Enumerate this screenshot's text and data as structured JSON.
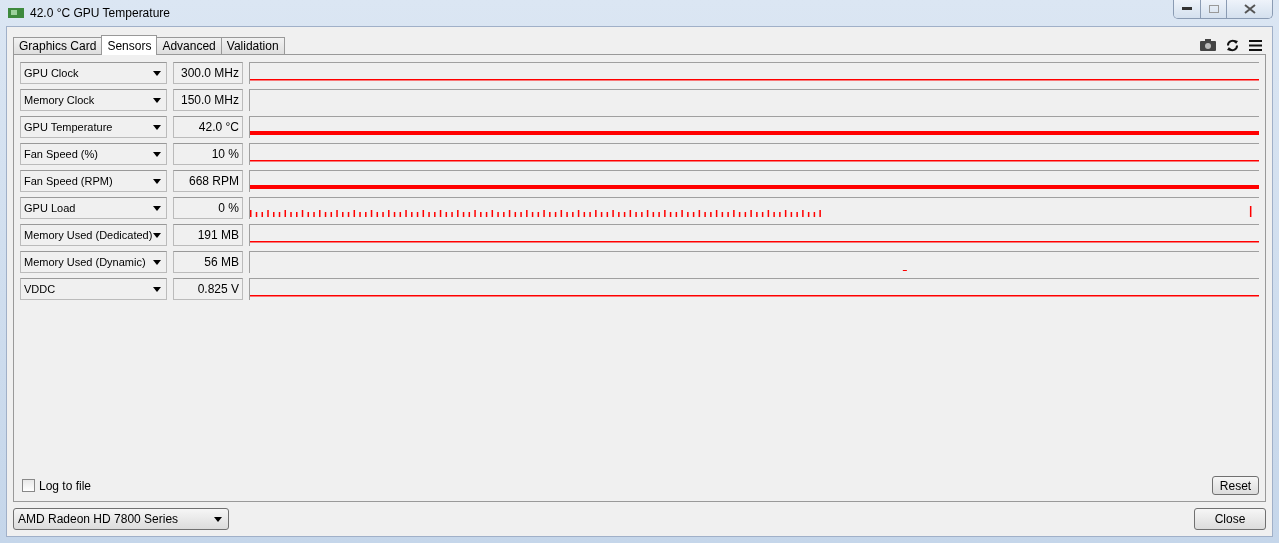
{
  "window": {
    "title": "42.0 °C GPU Temperature"
  },
  "tabs": [
    {
      "label": "Graphics Card",
      "selected": false
    },
    {
      "label": "Sensors",
      "selected": true
    },
    {
      "label": "Advanced",
      "selected": false
    },
    {
      "label": "Validation",
      "selected": false
    }
  ],
  "sensors": [
    {
      "name": "GPU Clock",
      "value": "300.0 MHz",
      "kind": "thin"
    },
    {
      "name": "Memory Clock",
      "value": "150.0 MHz",
      "kind": "empty"
    },
    {
      "name": "GPU Temperature",
      "value": "42.0 °C",
      "kind": "thick"
    },
    {
      "name": "Fan Speed (%)",
      "value": "10 %",
      "kind": "thin"
    },
    {
      "name": "Fan Speed (RPM)",
      "value": "668 RPM",
      "kind": "thick"
    },
    {
      "name": "GPU Load",
      "value": "0 %",
      "kind": "spikes"
    },
    {
      "name": "Memory Used (Dedicated)",
      "value": "191 MB",
      "kind": "thin"
    },
    {
      "name": "Memory Used (Dynamic)",
      "value": "56 MB",
      "kind": "blip"
    },
    {
      "name": "VDDC",
      "value": "0.825 V",
      "kind": "thin"
    }
  ],
  "log_to_file": {
    "label": "Log to file",
    "checked": false
  },
  "reset_button": "Reset",
  "gpu_select": "AMD Radeon HD 7800 Series",
  "close_button": "Close"
}
